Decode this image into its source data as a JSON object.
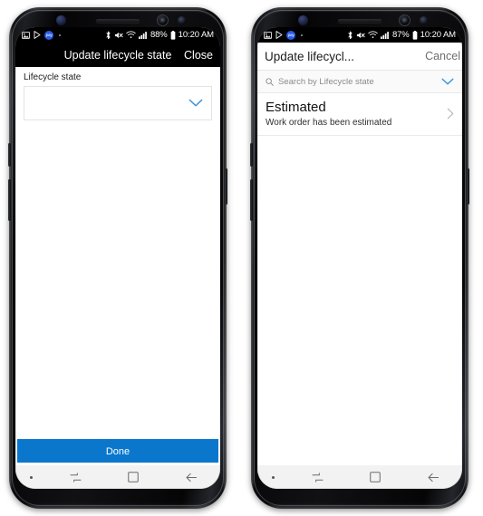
{
  "phones": [
    {
      "id": "phone-left",
      "status_bar": {
        "icons_left": [
          "image-icon",
          "play-store-icon",
          "app-badge-icon"
        ],
        "badge_text": "pay",
        "icons_right": [
          "bluetooth-icon",
          "mute-icon",
          "wifi-icon",
          "signal-icon"
        ],
        "battery_percent": "88%",
        "battery_icon": "battery-icon",
        "time": "10:20 AM"
      },
      "appbar": {
        "title": "Update lifecycle state",
        "action_label": "Close",
        "theme": "dark"
      },
      "form": {
        "field_label": "Lifecycle state",
        "select_value": "",
        "select_placeholder": "",
        "chevron_icon": "chevron-down-icon"
      },
      "footer": {
        "done_label": "Done"
      },
      "navbar": {
        "dot_icon": "nav-dot-icon",
        "recents_icon": "recents-icon",
        "home_icon": "home-square-icon",
        "back_icon": "back-arrow-icon"
      }
    },
    {
      "id": "phone-right",
      "status_bar": {
        "icons_left": [
          "image-icon",
          "play-store-icon",
          "app-badge-icon"
        ],
        "badge_text": "pay",
        "icons_right": [
          "bluetooth-icon",
          "mute-icon",
          "wifi-icon",
          "signal-icon"
        ],
        "battery_percent": "87%",
        "battery_icon": "battery-icon",
        "time": "10:20 AM"
      },
      "appbar": {
        "title": "Update lifecycl...",
        "action_label": "Cancel",
        "theme": "light"
      },
      "search": {
        "icon": "search-icon",
        "placeholder": "Search by Lifecycle state",
        "chevron_icon": "chevron-down-icon"
      },
      "results": [
        {
          "title": "Estimated",
          "subtitle": "Work order has been estimated",
          "chevron_icon": "chevron-right-icon"
        }
      ],
      "navbar": {
        "dot_icon": "nav-dot-icon",
        "recents_icon": "recents-icon",
        "home_icon": "home-square-icon",
        "back_icon": "back-arrow-icon"
      }
    }
  ],
  "colors": {
    "accent_blue": "#0a77cd",
    "chevron_blue": "#3b8fd6",
    "statusbar_bg": "#000000",
    "navbar_bg": "#f2f2f2",
    "badge_blue": "#2b5be5"
  }
}
